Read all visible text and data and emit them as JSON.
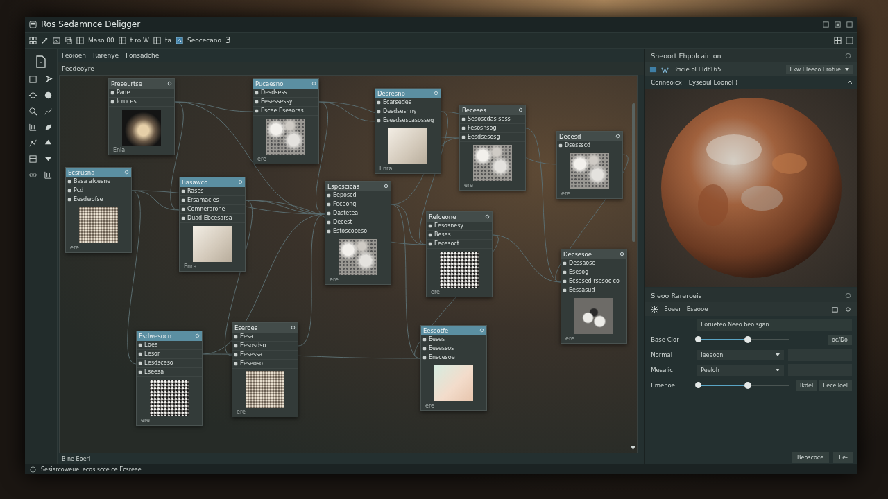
{
  "window": {
    "title": "Ros  Sedamnce Deligger"
  },
  "toolbar": {
    "items": [
      "Maso 00",
      "t ro W",
      "ta"
    ],
    "scene": "Seocecano",
    "scene_count": "3"
  },
  "menu": [
    "Feoioen",
    "Rarenye",
    "Fonsadche"
  ],
  "canvas_tab": "Pecdeoyre",
  "nodes": [
    {
      "title": "Preseurtse",
      "highlighted": false,
      "rows": [
        "Pane",
        "Icruces"
      ],
      "kind": "cloud",
      "caption": "Enia"
    },
    {
      "title": "Ecsrusna",
      "highlighted": true,
      "rows": [
        "Basa afcesne",
        "Pcd",
        "Eesdwofse"
      ],
      "kind": "grain",
      "caption": "ere"
    },
    {
      "title": "Basawco",
      "highlighted": true,
      "rows": [
        "Rases",
        "Ersamacles",
        "Comnerarone",
        "Duad Ebcesarsa"
      ],
      "kind": "soft",
      "caption": "Enra"
    },
    {
      "title": "Pucaesno",
      "highlighted": true,
      "rows": [
        "Desdsess",
        "Eesessessy",
        "Escee Esesoras"
      ],
      "kind": "mottled",
      "caption": "ere"
    },
    {
      "title": "Esposcicas",
      "highlighted": false,
      "rows": [
        "Eeposcd",
        "Feceong",
        "Dastetea",
        "Decest",
        "Estoscoceso"
      ],
      "kind": "mottled",
      "caption": "ere"
    },
    {
      "title": "Desresnp",
      "highlighted": true,
      "rows": [
        "Ecarsedes",
        "Desdsesnny",
        "Esesdsescasosseg"
      ],
      "kind": "soft",
      "caption": "Enra"
    },
    {
      "title": "Beceses",
      "highlighted": false,
      "rows": [
        "Sesoscdas sess",
        "Fesosnsog",
        "Eesdsesosg"
      ],
      "kind": "mottled",
      "caption": "ere"
    },
    {
      "title": "Decesd",
      "highlighted": false,
      "rows": [
        "Dsessscd"
      ],
      "kind": "mottled",
      "caption": "ere"
    },
    {
      "title": "Refceone",
      "highlighted": false,
      "rows": [
        "Eesosnesy",
        "Beses",
        "Eecesoct"
      ],
      "kind": "noise",
      "caption": "ere"
    },
    {
      "title": "Decsesoe",
      "highlighted": false,
      "rows": [
        "Dessaose",
        "Esesog",
        "Ecsesed rsesoc co",
        "Eessasud"
      ],
      "kind": "spots",
      "caption": "ere"
    },
    {
      "title": "Esdwesocn",
      "highlighted": true,
      "rows": [
        "Eoea",
        "Eesor",
        "Eesdsceso",
        "Eseesa"
      ],
      "kind": "noise",
      "caption": "ere"
    },
    {
      "title": "Eseroes",
      "highlighted": false,
      "rows": [
        "Eesa",
        "Eesosdso",
        "Eesessa",
        "Eeseoso"
      ],
      "kind": "grain",
      "caption": "ere"
    },
    {
      "title": "Eessotfe",
      "highlighted": true,
      "rows": [
        "Eeses",
        "Eesessos",
        "Enscesoe"
      ],
      "kind": "pastel",
      "caption": "ere"
    }
  ],
  "canvas_footer": "B ne Eberl",
  "status_bar": "Sesiarcoweuel ecos scce ce Ecsreee",
  "right_panel": {
    "title": "Sheoort Ehpolcain on",
    "toolbar_label": "Bficie ol Eldt165",
    "preset": "Fkw Eleeco Erotue",
    "view_label": "Conneoicx",
    "view_value": "Eyseoul Eoonol )",
    "section": "Sleoo Rarerceis",
    "group_a": "Eoeer",
    "group_b": "Eseooe",
    "shader": "Eorueteo  Neeo beolsgan",
    "properties": [
      {
        "kind": "slider",
        "label": "Base Clor",
        "level": 0.55,
        "value": "oc/Do"
      },
      {
        "kind": "dropdown",
        "label": "Normal",
        "value": "Ieeeoon"
      },
      {
        "kind": "dropdown",
        "label": "Mesalic",
        "value": "Peeloh"
      },
      {
        "kind": "slider",
        "label": "Emenoe",
        "level": 0.55,
        "value": "Ikdel",
        "value2": "Eecelloel"
      }
    ],
    "footer_buttons": [
      "Beoscoce",
      "Ee-"
    ]
  }
}
